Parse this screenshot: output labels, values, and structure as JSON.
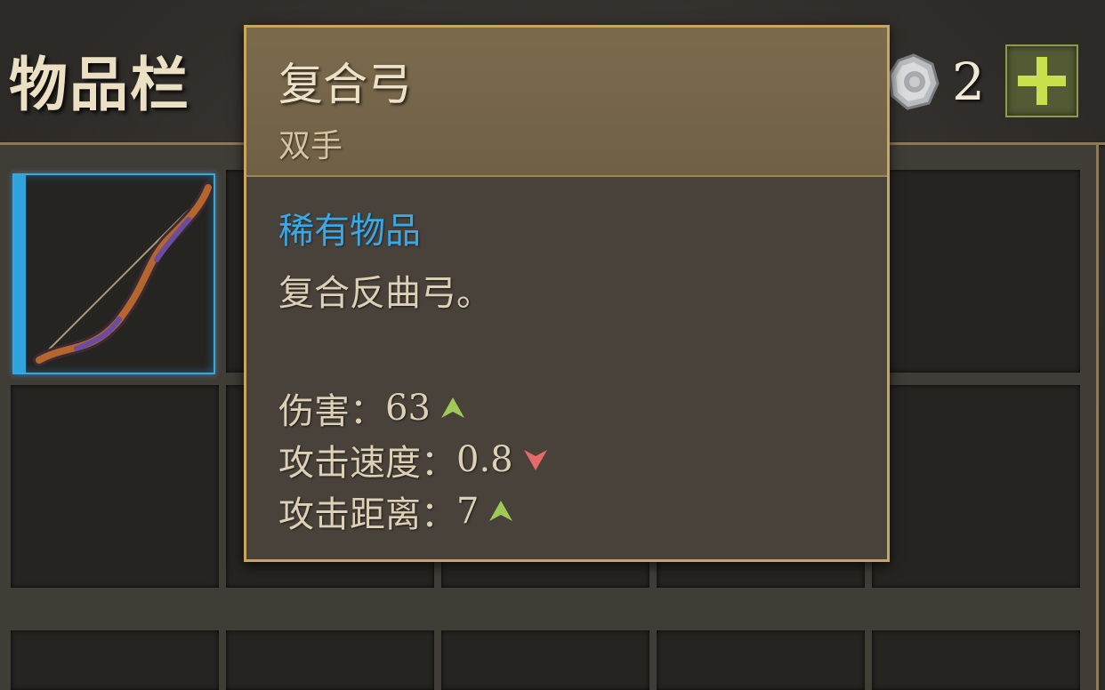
{
  "inventory": {
    "title": "物品栏"
  },
  "currency": {
    "icon": "silver-coin-icon",
    "count": "2",
    "add_icon": "plus-icon",
    "add_color": "#c7e04b"
  },
  "tooltip": {
    "name": "复合弓",
    "slot_type": "双手",
    "rarity": "稀有物品",
    "rarity_color": "#3aa7e6",
    "description": "复合反曲弓。",
    "stats": [
      {
        "label": "伤害：",
        "value": "63",
        "trend": "up"
      },
      {
        "label": "攻击速度：",
        "value": "0.8",
        "trend": "down"
      },
      {
        "label": "攻击距离：",
        "value": "7",
        "trend": "up"
      }
    ],
    "trend_colors": {
      "up": "#9fca58",
      "down": "#e76a6a"
    }
  },
  "grid": {
    "selected_item": "bow-icon"
  }
}
